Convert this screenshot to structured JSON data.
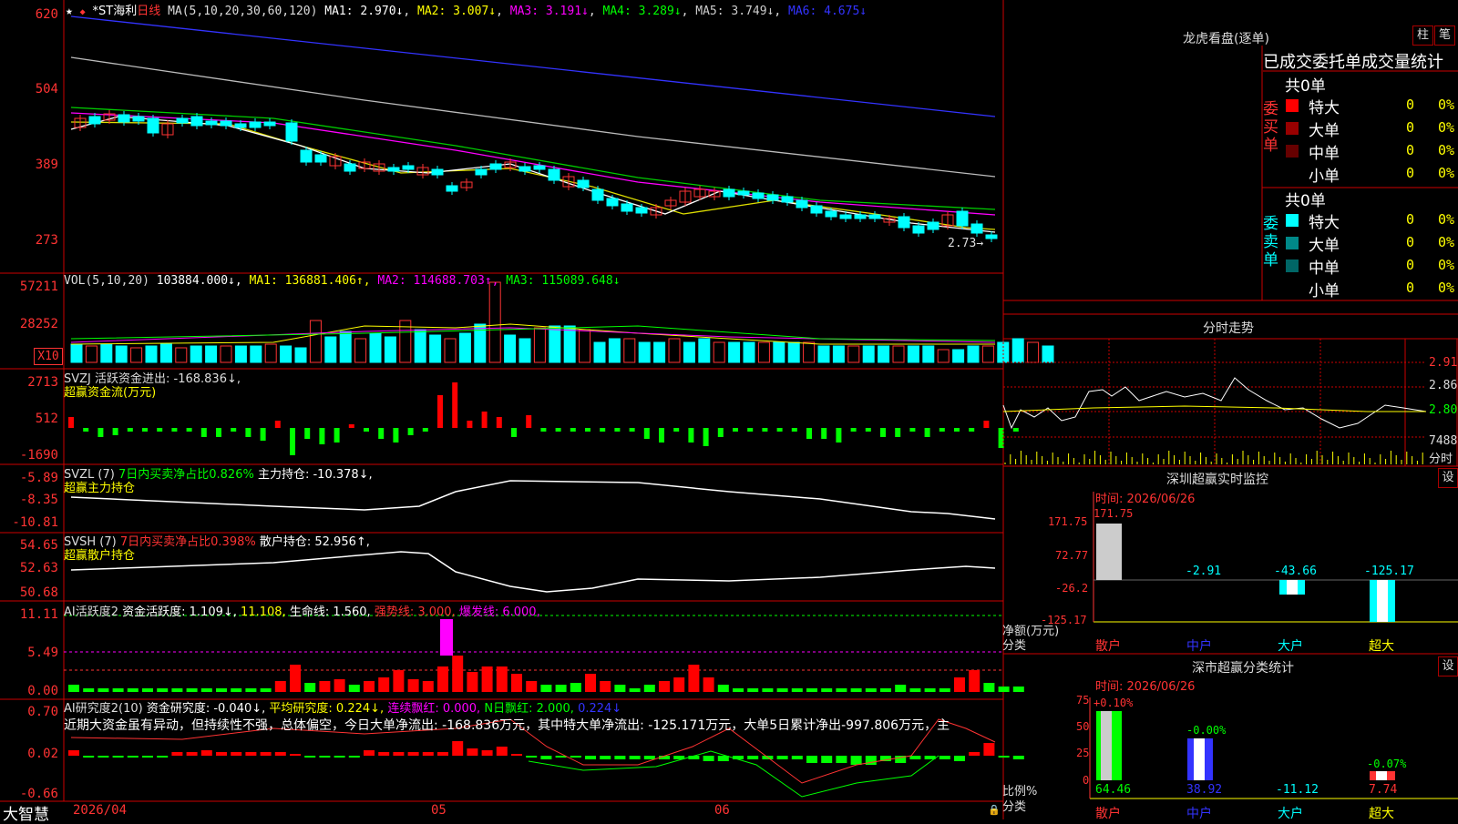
{
  "main": {
    "stock": "*ST海利",
    "period": "日线",
    "ma_label": "MA(5,10,20,30,60,120)",
    "ma1": "MA1: 2.970↓",
    "ma2": "MA2: 3.007↓",
    "ma3": "MA3: 3.191↓",
    "ma4": "MA4: 3.289↓",
    "ma5": "MA5: 3.749↓",
    "ma6": "MA6: 4.675↓",
    "y": [
      "620",
      "504",
      "389",
      "273"
    ],
    "last_price": "2.73"
  },
  "vol": {
    "label": "VOL(5,10,20)",
    "v": "103884.000↓,",
    "ma1": "MA1: 136881.406↑,",
    "ma2": "MA2: 114688.703↑,",
    "ma3": "MA3: 115089.648↓",
    "y": [
      "57211",
      "28252"
    ],
    "unit": "X10"
  },
  "svzj": {
    "l1": "SVZJ  活跃资金进出: -168.836↓,",
    "l2": "超赢资金流(万元)",
    "y": [
      "2713",
      "512",
      "-1690"
    ]
  },
  "svzl": {
    "l1a": "SVZL (7)",
    "l1b": "7日内买卖净占比0.826%",
    "l1c": "主力持仓: -10.378↓,",
    "l2": "超赢主力持仓",
    "y": [
      "-5.89",
      "-8.35",
      "-10.81"
    ]
  },
  "svsh": {
    "l1a": "SVSH (7)",
    "l1b": "7日内买卖净占比0.398%",
    "l1c": "散户持仓: 52.956↑,",
    "l2": "超赢散户持仓",
    "y": [
      "54.65",
      "52.63",
      "50.68"
    ]
  },
  "ai2": {
    "a": "AI活跃度2",
    "b": "资金活跃度: 1.109↓,",
    "c": "11.108,",
    "d": "生命线: 1.560,",
    "e": "强势线: 3.000,",
    "f": "爆发线: 6.000,",
    "y": [
      "11.11",
      "5.49",
      "0.00"
    ]
  },
  "air": {
    "a": "AI研究度2(10)",
    "b": "资金研究度: -0.040↓,",
    "c": "平均研究度: 0.224↓,",
    "d": "连续飘红: 0.000,",
    "e": "N日飘红: 2.000,",
    "f": "0.224↓",
    "text": "近期大资金虽有异动，但持续性不强，总体偏空，今日大单净流出: -168.836万元，其中特大单净流出: -125.171万元，大单5日累计净出-997.806万元，主",
    "y": [
      "0.70",
      "0.02",
      "-0.66"
    ]
  },
  "dates": {
    "d1": "2026/04",
    "d2": "05",
    "d3": "06"
  },
  "brand": "大智慧",
  "lh": {
    "title": "龙虎看盘(逐单)",
    "btn1": "柱",
    "btn2": "笔",
    "tabs": "已成交委托单成交量统计",
    "buy_group": "委买单",
    "sell_group": "委卖单",
    "buy_total": "共0单",
    "sell_total": "共0单",
    "buy_rows": [
      {
        "name": "特大",
        "n": "0",
        "p": "0%",
        "color": "#ff0000"
      },
      {
        "name": "大单",
        "n": "0",
        "p": "0%",
        "color": "#990000"
      },
      {
        "name": "中单",
        "n": "0",
        "p": "0%",
        "color": "#660000"
      },
      {
        "name": "小单",
        "n": "0",
        "p": "0%",
        "color": "#000000"
      }
    ],
    "sell_rows": [
      {
        "name": "特大",
        "n": "0",
        "p": "0%",
        "color": "#00ffff"
      },
      {
        "name": "大单",
        "n": "0",
        "p": "0%",
        "color": "#008888"
      },
      {
        "name": "中单",
        "n": "0",
        "p": "0%",
        "color": "#006666"
      },
      {
        "name": "小单",
        "n": "0",
        "p": "0%",
        "color": "#000000"
      }
    ]
  },
  "fs": {
    "title": "分时走势",
    "y": [
      "2.915",
      "2.860",
      "2.805",
      "7488"
    ],
    "unit": "分时"
  },
  "sz": {
    "title": "深圳超赢实时监控",
    "btn": "设",
    "time": "时间: 2026/06/26",
    "y": [
      "171.75",
      "72.77",
      "-26.2",
      "-125.17"
    ],
    "vals": [
      "171.75",
      "-2.91",
      "-43.66",
      "-125.17"
    ],
    "ylab": "净额(万元)",
    "xlab": "分类",
    "cats": [
      "散户",
      "中户",
      "大户",
      "超大"
    ]
  },
  "sc": {
    "title": "深市超赢分类统计",
    "btn": "设",
    "time": "时间: 2026/06/26",
    "y": [
      "75",
      "50",
      "25",
      "0"
    ],
    "tops": [
      "+0.10%",
      "-0.00%",
      "",
      "-0.07%"
    ],
    "vals": [
      "64.46",
      "38.92",
      "-11.12",
      "7.74"
    ],
    "ylab": "比例%",
    "xlab": "分类",
    "cats": [
      "散户",
      "中户",
      "大户",
      "超大"
    ]
  }
}
